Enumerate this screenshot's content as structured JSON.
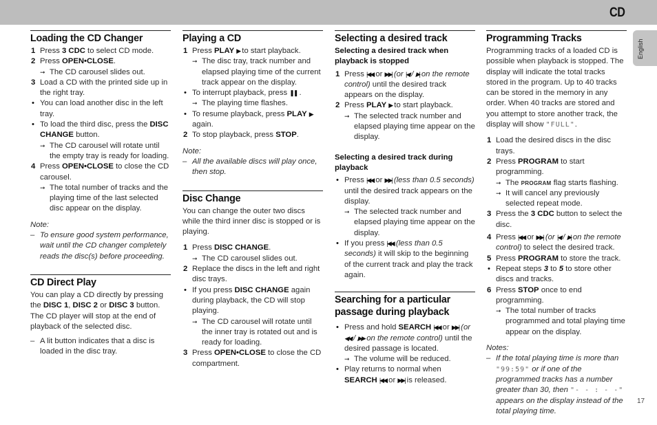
{
  "header": {
    "section": "CD"
  },
  "language_tab": "English",
  "page_number": "17",
  "icons": {
    "play": "▶",
    "pause": "❚❚",
    "prev": "|◀◀",
    "next": "▶▶|",
    "remote_prev": "|◀",
    "remote_next": "▶|",
    "rewind": "◀◀",
    "ffwd": "▶▶",
    "arrow": "➞"
  },
  "loading": {
    "title": "Loading the CD Changer",
    "s1_num": "1",
    "s1_pre": "Press ",
    "s1_b": "3 CDC",
    "s1_post": " to select CD mode.",
    "s2_num": "2",
    "s2_pre": "Press ",
    "s2_b": "OPEN•CLOSE",
    "s2_post": ".",
    "s2_res": "The CD carousel slides out.",
    "s3_num": "3",
    "s3_text": "Load a CD with the printed side up in the right tray.",
    "b1_text": "You can load another disc in the left tray.",
    "b2_pre": "To load the third disc, press the ",
    "b2_b": "DISC CHANGE",
    "b2_post": " button.",
    "b2_res": "The CD carousel will rotate until the empty tray is ready for loading.",
    "s4_num": "4",
    "s4_pre": "Press ",
    "s4_b": "OPEN•CLOSE",
    "s4_post": " to close the CD carousel.",
    "s4_res": "The total number of tracks and the playing time of the last selected disc appear on the display.",
    "note_title": "Note:",
    "note_text": "To ensure good system performance, wait until the CD changer completely reads the disc(s) before proceeding."
  },
  "direct": {
    "title": "CD Direct Play",
    "p_pre": "You can play a CD directly by pressing the ",
    "p_b1": "DISC 1",
    "p_sep1": ", ",
    "p_b2": "DISC 2",
    "p_sep2": " or ",
    "p_b3": "DISC 3",
    "p_post": " button. The CD player will stop at the end of playback of the selected disc.",
    "dash_text": "A lit button indicates that a disc is loaded in the disc tray."
  },
  "playing": {
    "title": "Playing a CD",
    "s1_num": "1",
    "s1_pre": "Press ",
    "s1_b": "PLAY",
    "s1_post": "  to start playback.",
    "s1_res": "The disc tray, track number and elapsed playing time of the current track appear on the display.",
    "b1_pre": "To interrupt playback, press ",
    "b1_post": " .",
    "b1_res": "The playing time flashes.",
    "b2_pre": "To resume playback, press ",
    "b2_b": "PLAY",
    "b2_post": " again.",
    "s2_num": "2",
    "s2_pre": "To stop playback, press ",
    "s2_b": "STOP",
    "s2_post": ".",
    "note_title": "Note:",
    "note_text": "All the available discs will play once, then stop."
  },
  "disc_change": {
    "title": "Disc Change",
    "intro": "You can change the outer two discs while the third inner disc is stopped or is playing.",
    "s1_num": "1",
    "s1_pre": "Press ",
    "s1_b": "DISC CHANGE",
    "s1_post": ".",
    "s1_res": "The CD carousel slides out.",
    "s2_num": "2",
    "s2_text": "Replace the discs in the left and right disc trays.",
    "b1_pre": "If you press ",
    "b1_b": "DISC CHANGE",
    "b1_post": " again during playback, the CD will stop playing.",
    "b1_res": "The CD carousel will rotate until the inner tray is rotated out and is ready for loading.",
    "s3_num": "3",
    "s3_pre": "Press ",
    "s3_b": "OPEN•CLOSE",
    "s3_post": " to close the CD compartment."
  },
  "selecting": {
    "title": "Selecting a desired track",
    "sub1": "Selecting a desired track when playback is stopped",
    "s1_num": "1",
    "s1_pre": "Press ",
    "s1_or": " or ",
    "s1_i_pre": " (or ",
    "s1_i_slash": " / ",
    "s1_i_post": " on the remote control)",
    "s1_post": " until the desired track appears on the display.",
    "s2_num": "2",
    "s2_pre": "Press ",
    "s2_b": "PLAY",
    "s2_post": "  to start playback.",
    "s2_res": "The selected track number and elapsed playing time appear on the display.",
    "sub2": "Selecting a desired track during playback",
    "b1_pre": "Press ",
    "b1_or": " or ",
    "b1_i": " (less than 0.5 seconds)",
    "b1_post": " until the desired track appears on the display.",
    "b1_res": "The selected track number and elapsed playing time appear on the display.",
    "b2_pre": "If you press ",
    "b2_i": " (less than 0.5 seconds)",
    "b2_post": " it will skip to the beginning of the current track and play the track again."
  },
  "searching": {
    "title": "Searching for a particular passage during playback",
    "b1_pre": "Press and hold ",
    "b1_b": "SEARCH",
    "b1_or": " or ",
    "b1_i_pre": " (or ",
    "b1_i_slash": " / ",
    "b1_i_post": " on the remote control)",
    "b1_post": " until the desired passage is located.",
    "b1_res": "The volume will be reduced.",
    "b2_pre": "Play returns to normal when ",
    "b2_b": "SEARCH",
    "b2_or": " or ",
    "b2_post": " is released."
  },
  "programming": {
    "title": "Programming Tracks",
    "intro": "Programming tracks of a loaded CD is possible when playback is stopped. The display will indicate the total tracks stored in the program. Up to 40 tracks can be stored in the memory in any order. When 40 tracks are stored and you attempt to store another track, the display will show ",
    "intro_lcd": "\"FULL\"",
    "intro_end": ".",
    "s1_num": "1",
    "s1_text": "Load the desired discs in the disc trays.",
    "s2_num": "2",
    "s2_pre": "Press ",
    "s2_b": "PROGRAM",
    "s2_post": " to start programming.",
    "s2_res1_pre": "The ",
    "s2_res1_flag": "PROGRAM",
    "s2_res1_post": " flag starts flashing.",
    "s2_res2": "It will cancel any previously selected repeat mode.",
    "s3_num": "3",
    "s3_pre": "Press the ",
    "s3_b": "3 CDC",
    "s3_post": " button to select the disc.",
    "s4_num": "4",
    "s4_pre": "Press ",
    "s4_or": " or ",
    "s4_i_pre": " (or ",
    "s4_i_slash": " / ",
    "s4_i_post": " on the remote control)",
    "s4_post": " to select the desired track.",
    "s5_num": "5",
    "s5_pre": "Press ",
    "s5_b": "PROGRAM",
    "s5_post": " to store the track.",
    "b1_pre": "Repeat steps ",
    "b1_n1": "3",
    "b1_mid": " to ",
    "b1_n2": "5",
    "b1_post": " to store other discs and tracks.",
    "s6_num": "6",
    "s6_pre": "Press ",
    "s6_b": "STOP",
    "s6_post": " once to end programming.",
    "s6_res": "The total number of tracks programmed and total playing time appear on the display.",
    "notes_title": "Notes:",
    "note_pre": "If the total playing time is more than ",
    "note_lcd1": "\"99:59\"",
    "note_mid": " or if one of the programmed tracks has a number greater than 30, then ",
    "note_lcd2": "\"- - : - -\"",
    "note_post": " appears on the display instead of the total playing time."
  }
}
